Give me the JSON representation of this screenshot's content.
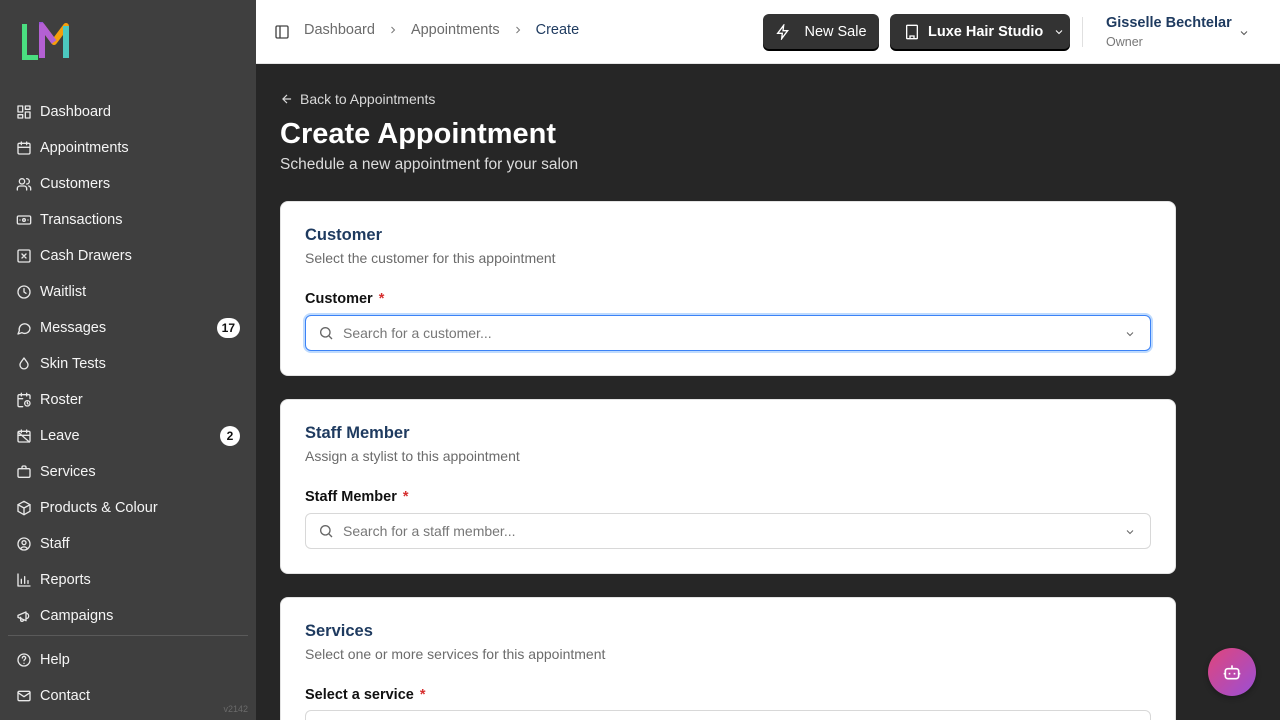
{
  "sidebar": {
    "items": [
      {
        "label": "Dashboard",
        "icon": "dashboard-icon"
      },
      {
        "label": "Appointments",
        "icon": "calendar-icon"
      },
      {
        "label": "Customers",
        "icon": "users-icon"
      },
      {
        "label": "Transactions",
        "icon": "banknote-icon"
      },
      {
        "label": "Cash Drawers",
        "icon": "drawer-icon"
      },
      {
        "label": "Waitlist",
        "icon": "clock-icon"
      },
      {
        "label": "Messages",
        "icon": "message-icon",
        "badge": "17"
      },
      {
        "label": "Skin Tests",
        "icon": "droplet-icon"
      },
      {
        "label": "Roster",
        "icon": "calendar-clock-icon"
      },
      {
        "label": "Leave",
        "icon": "calendar-x-icon",
        "badge": "2"
      },
      {
        "label": "Services",
        "icon": "briefcase-icon"
      },
      {
        "label": "Products & Colour",
        "icon": "package-icon"
      },
      {
        "label": "Staff",
        "icon": "user-circle-icon"
      },
      {
        "label": "Reports",
        "icon": "chart-icon"
      },
      {
        "label": "Campaigns",
        "icon": "megaphone-icon"
      }
    ],
    "footer_items": [
      {
        "label": "Help",
        "icon": "help-icon"
      },
      {
        "label": "Contact",
        "icon": "mail-icon"
      }
    ],
    "version": "v2142"
  },
  "header": {
    "breadcrumbs": [
      "Dashboard",
      "Appointments",
      "Create"
    ],
    "new_sale_label": "New Sale",
    "studio_label": "Luxe Hair Studio",
    "user_name": "Gisselle Bechtelar",
    "user_role": "Owner"
  },
  "main": {
    "back_label": "Back to Appointments",
    "title": "Create Appointment",
    "subtitle": "Schedule a new appointment for your salon",
    "customer_card": {
      "title": "Customer",
      "description": "Select the customer for this appointment",
      "field_label": "Customer",
      "required": "*",
      "placeholder": "Search for a customer..."
    },
    "staff_card": {
      "title": "Staff Member",
      "description": "Assign a stylist to this appointment",
      "field_label": "Staff Member",
      "required": "*",
      "placeholder": "Search for a staff member..."
    },
    "services_card": {
      "title": "Services",
      "description": "Select one or more services for this appointment",
      "field_label": "Select a service",
      "required": "*"
    }
  },
  "colors": {
    "sidebar_bg": "#3f3f3f",
    "main_bg": "#262626",
    "accent_blue": "#1e3a5f",
    "required_red": "#d62f2f",
    "focus_blue": "#3b82f6"
  }
}
